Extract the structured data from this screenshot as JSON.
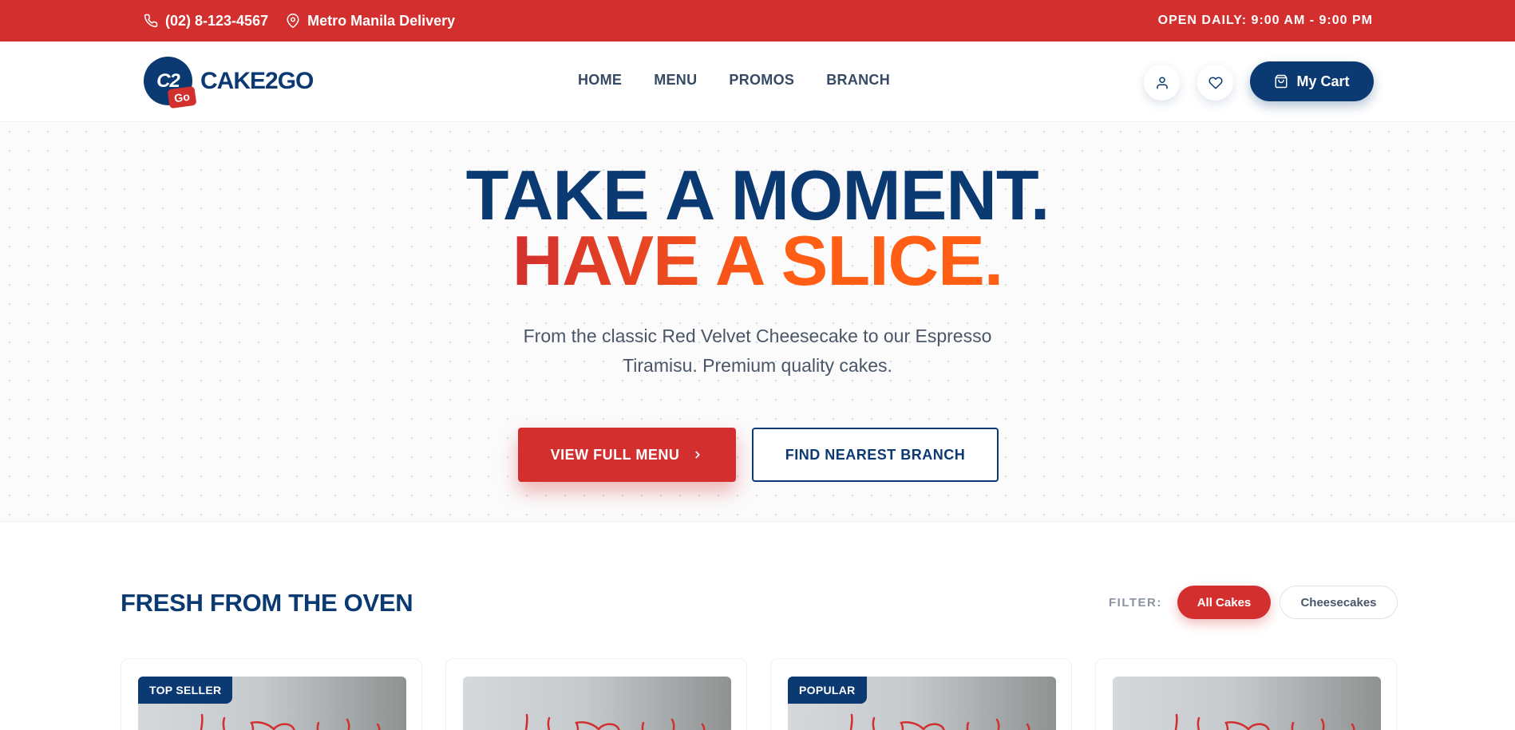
{
  "topbar": {
    "phone": "(02) 8-123-4567",
    "location": "Metro Manila Delivery",
    "hours": "OPEN DAILY: 9:00 AM - 9:00 PM"
  },
  "brand": {
    "badge_text": "C2",
    "badge_sub": "Go",
    "name": "CAKE2GO"
  },
  "nav": {
    "items": [
      "HOME",
      "MENU",
      "PROMOS",
      "BRANCH"
    ]
  },
  "header_actions": {
    "account_icon": "user-icon",
    "wishlist_icon": "heart-icon",
    "cart_label": "My Cart",
    "cart_icon": "shopping-bag-icon"
  },
  "hero": {
    "line1": "TAKE A MOMENT.",
    "line2_part1": "HAVE A ",
    "line2_part2": "SLICE.",
    "subtitle": "From the classic Red Velvet Cheesecake to our Espresso Tiramisu. Premium quality cakes.",
    "primary_cta": "VIEW FULL MENU",
    "secondary_cta": "FIND NEAREST BRANCH"
  },
  "products": {
    "title": "FRESH FROM THE OVEN",
    "filter_label": "FILTER:",
    "filters": [
      "All Cakes",
      "Cheesecakes"
    ],
    "active_filter": "All Cakes",
    "cards": [
      {
        "badge": "TOP SELLER"
      },
      {
        "badge": ""
      },
      {
        "badge": "POPULAR"
      },
      {
        "badge": ""
      }
    ]
  },
  "colors": {
    "primary_navy": "#0b3a73",
    "accent_red": "#d32f2f",
    "accent_orange": "#ff5e14"
  }
}
